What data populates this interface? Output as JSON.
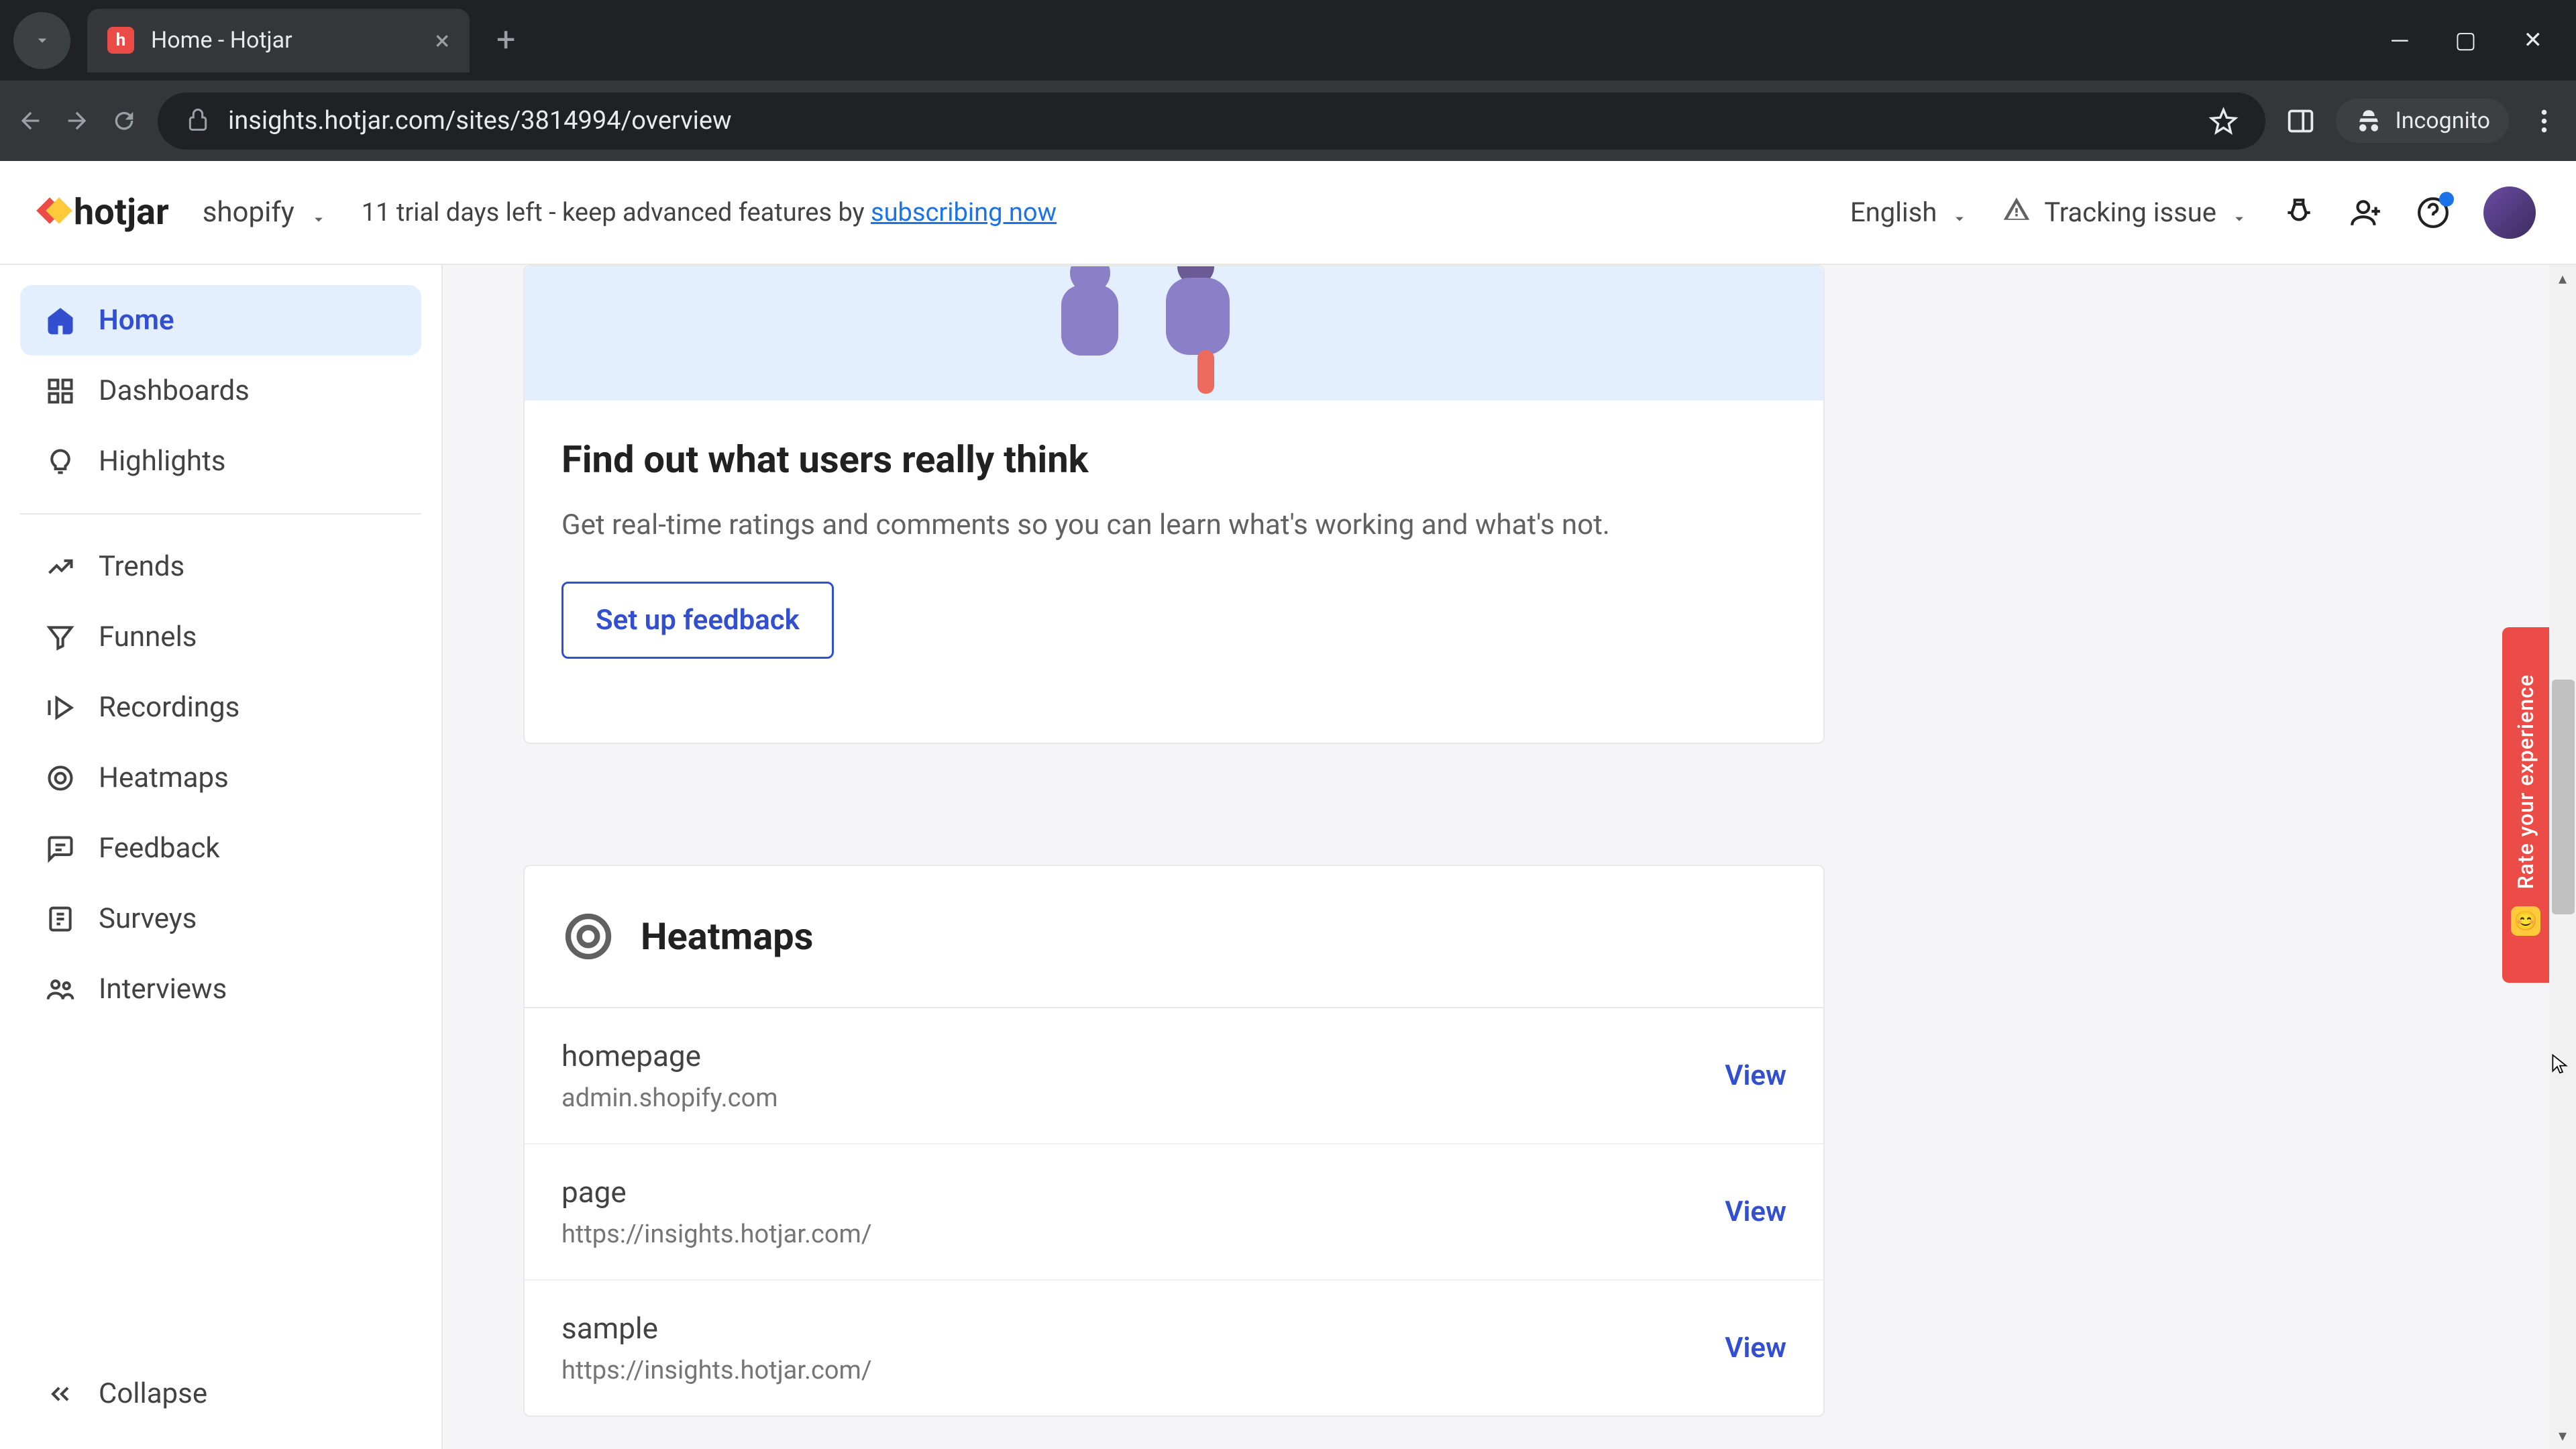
{
  "browser": {
    "tab_title": "Home - Hotjar",
    "url": "insights.hotjar.com/sites/3814994/overview",
    "incognito_label": "Incognito"
  },
  "topbar": {
    "logo": "hotjar",
    "site": "shopify",
    "trial_prefix": "11 trial days left - keep advanced features by ",
    "trial_link": "subscribing now",
    "language": "English",
    "tracking": "Tracking issue"
  },
  "sidebar": {
    "items": [
      {
        "label": "Home"
      },
      {
        "label": "Dashboards"
      },
      {
        "label": "Highlights"
      },
      {
        "label": "Trends"
      },
      {
        "label": "Funnels"
      },
      {
        "label": "Recordings"
      },
      {
        "label": "Heatmaps"
      },
      {
        "label": "Feedback"
      },
      {
        "label": "Surveys"
      },
      {
        "label": "Interviews"
      }
    ],
    "collapse": "Collapse"
  },
  "feedback_card": {
    "title": "Find out what users really think",
    "subtitle": "Get real-time ratings and comments so you can learn what's working and what's not.",
    "button": "Set up feedback"
  },
  "heatmaps_card": {
    "title": "Heatmaps",
    "rows": [
      {
        "name": "homepage",
        "url": "admin.shopify.com",
        "action": "View"
      },
      {
        "name": "page",
        "url": "https://insights.hotjar.com/",
        "action": "View"
      },
      {
        "name": "sample",
        "url": "https://insights.hotjar.com/",
        "action": "View"
      }
    ]
  },
  "rate_tab": "Rate your experience"
}
